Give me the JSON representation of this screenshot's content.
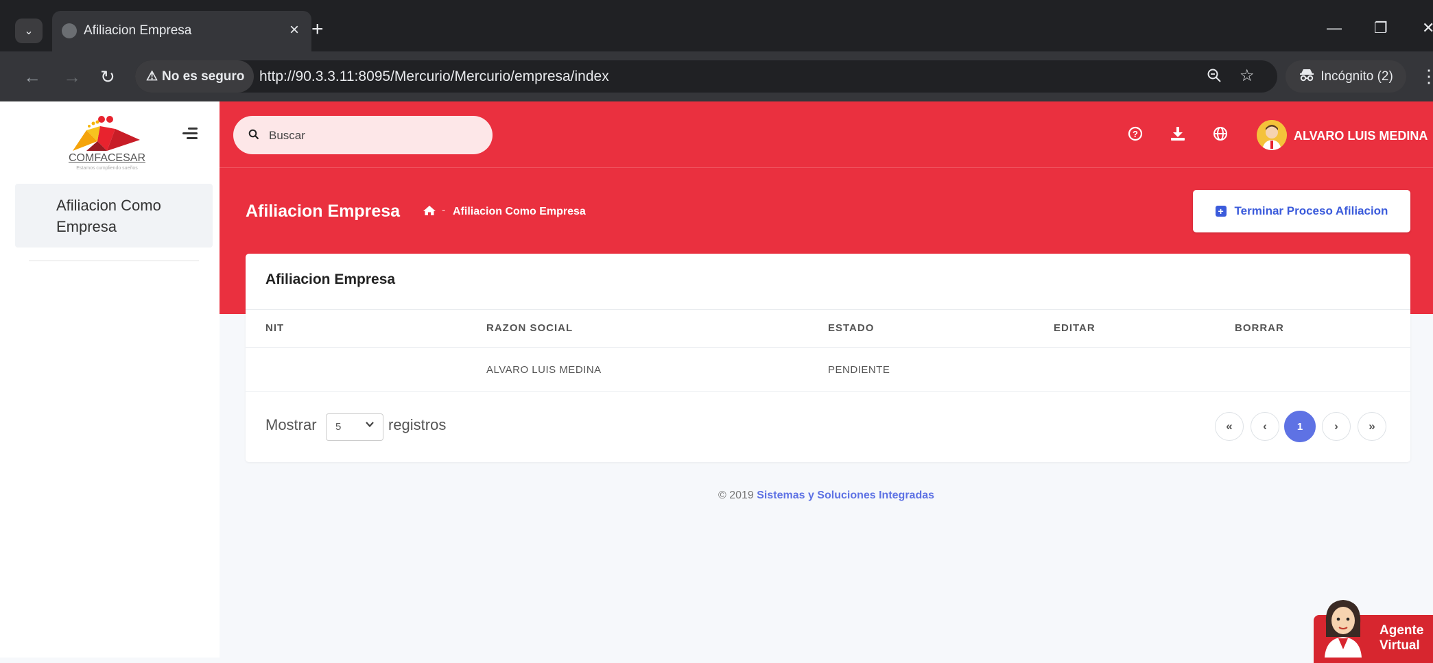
{
  "browser": {
    "tab_title": "Afiliacion Empresa",
    "tab_close": "×",
    "new_tab": "+",
    "insecure_label": "No es seguro",
    "url": "http://90.3.3.11:8095/Mercurio/Mercurio/empresa/index",
    "incognito_label": "Incógnito (2)"
  },
  "sidebar": {
    "logo_text": "COMFACESAR",
    "logo_tagline": "Estamos cumpliendo sueños",
    "items": [
      {
        "label": "Afiliacion Como Empresa"
      }
    ]
  },
  "header": {
    "search_placeholder": "Buscar",
    "user_name": "ALVARO LUIS MEDINA"
  },
  "page": {
    "title": "Afiliacion Empresa",
    "breadcrumb_sep": "-",
    "breadcrumb_current": "Afiliacion Como Empresa",
    "finish_button": "Terminar Proceso Afiliacion"
  },
  "card": {
    "title": "Afiliacion Empresa",
    "columns": [
      "NIT",
      "RAZON SOCIAL",
      "ESTADO",
      "EDITAR",
      "BORRAR"
    ],
    "rows": [
      {
        "nit": "",
        "razon_social": "ALVARO LUIS MEDINA",
        "estado": "PENDIENTE",
        "editar": "",
        "borrar": ""
      }
    ],
    "show_prefix": "Mostrar",
    "show_value": "5",
    "show_suffix": "registros",
    "pagination": {
      "first": "«",
      "prev": "‹",
      "current": "1",
      "next": "›",
      "last": "»"
    }
  },
  "footer": {
    "copyright": "© 2019",
    "link": "Sistemas y Soluciones Integradas"
  },
  "agent": {
    "label_line1": "Agente",
    "label_line2": "Virtual"
  },
  "colors": {
    "brand_red": "#ea303f",
    "accent_blue": "#5e72e4",
    "button_blue": "#3b5bdb"
  }
}
